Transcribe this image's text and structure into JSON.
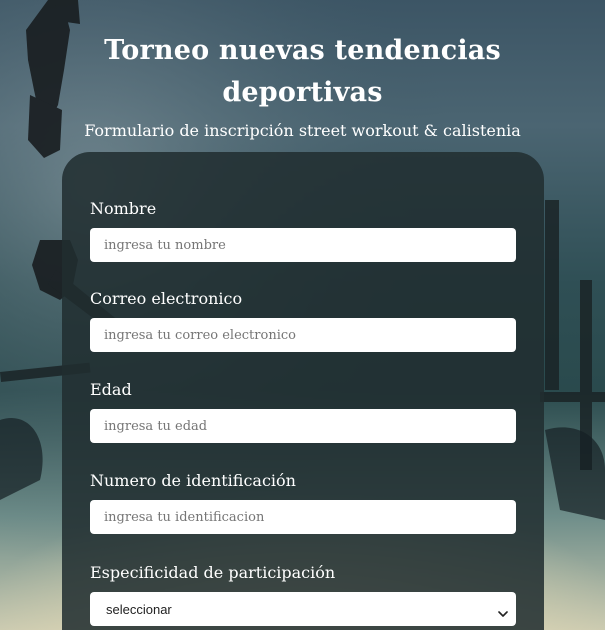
{
  "header": {
    "title_line1": "Torneo nuevas tendencias",
    "title_line2": "deportivas",
    "subtitle": "Formulario de inscripción street workout & calistenia"
  },
  "form": {
    "fields": [
      {
        "label": "Nombre",
        "placeholder": "ingresa tu nombre"
      },
      {
        "label": "Correo electronico",
        "placeholder": "ingresa tu correo electronico"
      },
      {
        "label": "Edad",
        "placeholder": "ingresa tu edad"
      },
      {
        "label": "Numero de identificación",
        "placeholder": "ingresa tu identificacion"
      }
    ],
    "participation": {
      "label": "Especificidad de participación",
      "selected": "seleccionar"
    }
  },
  "icons": {
    "dropdown": "chevron-down-icon"
  },
  "colors": {
    "card_bg": "#212d30",
    "text": "#ffffff",
    "input_bg": "#ffffff",
    "placeholder": "#757575"
  }
}
